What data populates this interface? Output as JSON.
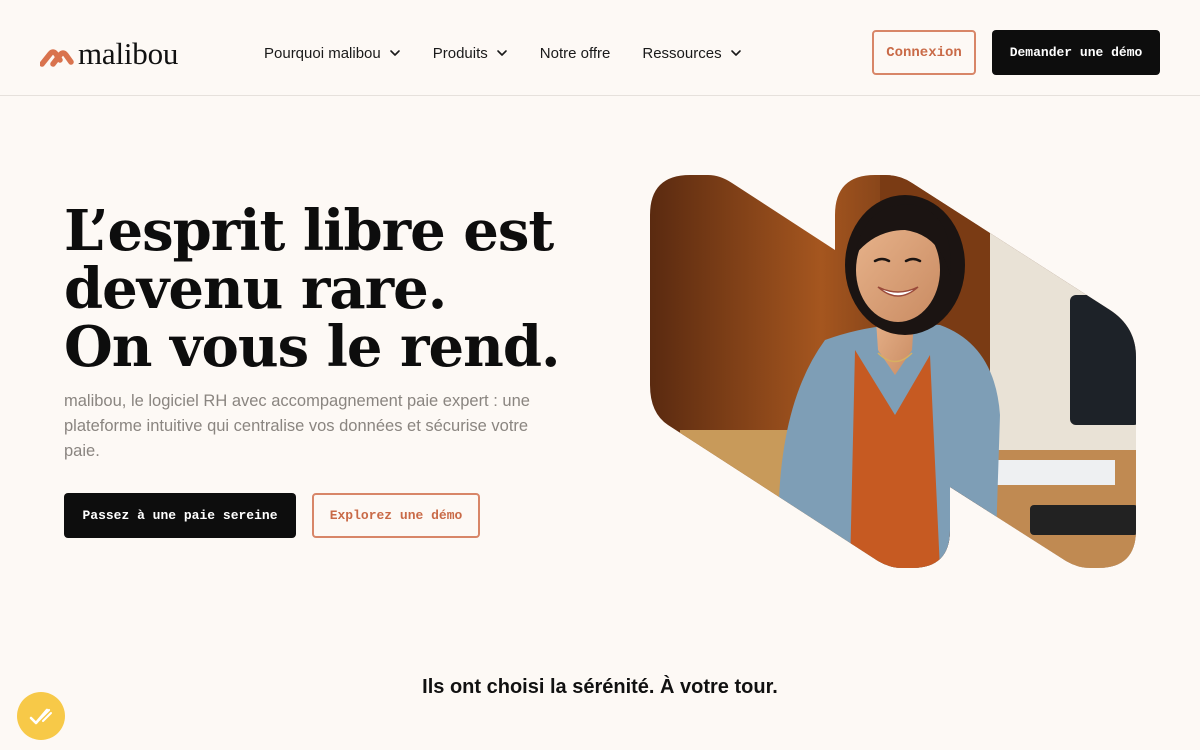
{
  "brand": {
    "name": "malibou",
    "accent": "#d9734e",
    "logo_icon": "malibou-wave-logo"
  },
  "nav": {
    "items": [
      {
        "label": "Pourquoi malibou",
        "has_dropdown": true
      },
      {
        "label": "Produits",
        "has_dropdown": true
      },
      {
        "label": "Notre offre",
        "has_dropdown": false
      },
      {
        "label": "Ressources",
        "has_dropdown": true
      }
    ],
    "login_label": "Connexion",
    "demo_label": "Demander une démo"
  },
  "hero": {
    "title_lines": [
      "L’esprit libre est",
      "devenu rare.",
      "On vous le rend."
    ],
    "subtitle": "malibou, le logiciel RH avec accompagnement paie expert : une plateforme intuitive qui centralise vos données et sécurise votre paie.",
    "primary_cta": "Passez à une paie sereine",
    "secondary_cta": "Explorez une démo",
    "image_icon": "smiling-woman-at-desk-photo"
  },
  "trust": {
    "text": "Ils ont choisi la sérénité. À votre tour."
  },
  "widget": {
    "icon": "accessibility-check-icon",
    "color": "#f7c948"
  },
  "colors": {
    "background": "#fdf9f5",
    "dark": "#0d0d0d",
    "outline": "#d88668",
    "muted_text": "#8a8580"
  }
}
